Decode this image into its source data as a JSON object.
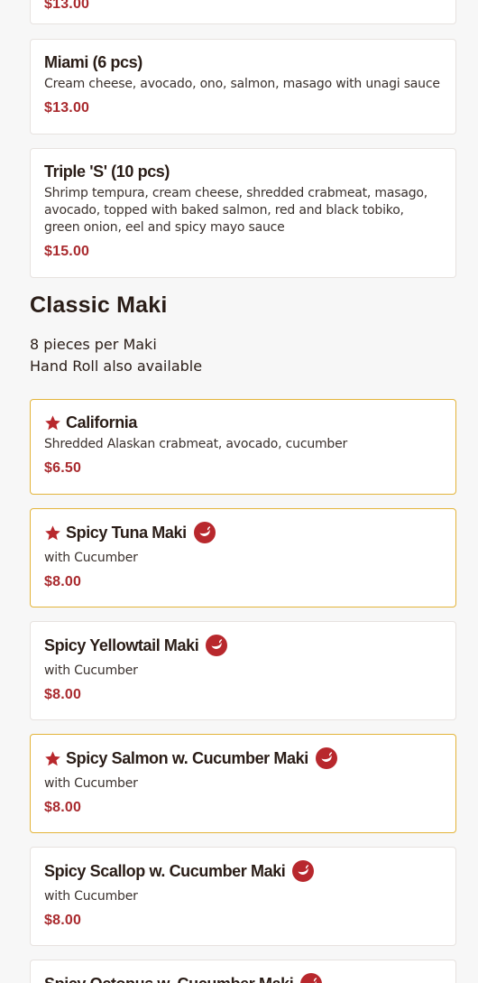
{
  "items_top": [
    {
      "price": "$13.00"
    },
    {
      "title": "Miami (6 pcs)",
      "desc": "Cream cheese, avocado, ono, salmon, masago with unagi sauce",
      "price": "$13.00"
    },
    {
      "title": "Triple 'S' (10 pcs)",
      "desc": "Shrimp tempura, cream cheese, shredded crabmeat, masago, avocado, topped with baked salmon, red and black tobiko, green onion, eel and spicy mayo sauce",
      "price": "$15.00"
    }
  ],
  "section": {
    "title": "Classic Maki",
    "note_line1": "8 pieces per Maki",
    "note_line2": "Hand Roll also available"
  },
  "items": [
    {
      "title": "California",
      "desc": "Shredded Alaskan crabmeat, avocado, cucumber",
      "price": "$6.50",
      "featured": true,
      "spicy": false
    },
    {
      "title": "Spicy Tuna Maki",
      "desc": "with Cucumber",
      "price": "$8.00",
      "featured": true,
      "spicy": true
    },
    {
      "title": "Spicy Yellowtail Maki",
      "desc": "with Cucumber",
      "price": "$8.00",
      "featured": false,
      "spicy": true
    },
    {
      "title": "Spicy Salmon w. Cucumber Maki",
      "desc": "with Cucumber",
      "price": "$8.00",
      "featured": true,
      "spicy": true
    },
    {
      "title": "Spicy Scallop w. Cucumber Maki",
      "desc": "with Cucumber",
      "price": "$8.00",
      "featured": false,
      "spicy": true
    },
    {
      "title": "Spicy Octopus w. Cucumber Maki",
      "featured": false,
      "spicy": true
    }
  ],
  "colors": {
    "price": "#a92a2e",
    "featured_border": "#e3b43a",
    "star": "#b8282d",
    "chili_badge": "#b8282d"
  },
  "icons": {
    "featured": "star-icon",
    "spicy": "chili-pepper-icon"
  }
}
